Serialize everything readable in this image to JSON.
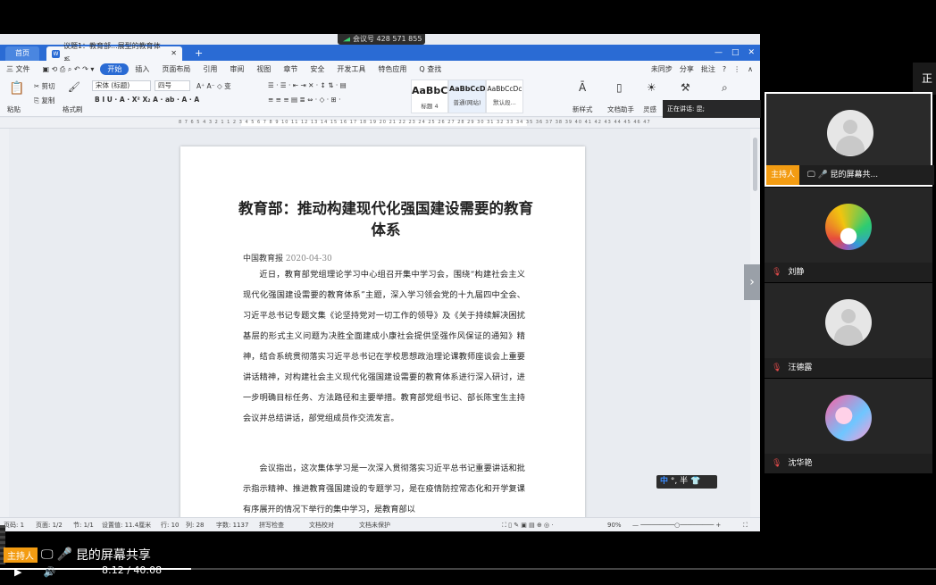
{
  "meeting": {
    "id_text": "会议号 428 571 855"
  },
  "wps": {
    "tabs": {
      "home": "首页",
      "doc": "议题1：教育部...展型的教育体系"
    },
    "menu": [
      "三 文件",
      "开始",
      "插入",
      "页面布局",
      "引用",
      "审阅",
      "视图",
      "章节",
      "安全",
      "开发工具",
      "特色应用",
      "Q 查找"
    ],
    "menu_active": "开始",
    "menu_right": [
      "未同步",
      "分享",
      "批注",
      "?"
    ],
    "ribbon": {
      "paste": "粘贴",
      "cut": "剪切",
      "copy": "复制",
      "format_painter": "格式刷",
      "font_name": "宋体 (标题)",
      "font_size": "四号",
      "styles": [
        {
          "preview": "AaBbC",
          "name": "标题 4"
        },
        {
          "preview": "AaBbCcD",
          "name": "普通(网站)"
        },
        {
          "preview": "AaBbCcDc",
          "name": "默认段..."
        }
      ],
      "new_style": "新样式",
      "doc_assistant": "文档助手",
      "inspire": "灵感"
    },
    "ruler_numbers": "8 7 6 5 4 3 2 1 1 2 3 4 5 6 7 8 9 10 11 12 13 14 15 16 17 18 19 20 21 22 23 24 25 26 27 28 29 30 31 32 33 34 35 36 37 38 39 40 41 42 43 44 45 46 47",
    "status": {
      "page_count": "页码: 1",
      "pages": "页面: 1/2",
      "section": "节: 1/1",
      "setting": "设置值: 11.4厘米",
      "row": "行: 10",
      "col": "列: 28",
      "words": "字数: 1137",
      "spell": "拼写检查",
      "proof": "文档校对",
      "protect": "文档未保护",
      "zoom": "90%"
    }
  },
  "document": {
    "title": "教育部：推动构建现代化强国建设需要的教育体系",
    "source": "中国教育报",
    "date": "2020-04-30",
    "para1": "近日，教育部党组理论学习中心组召开集中学习会，围绕“构建社会主义现代化强国建设需要的教育体系”主题，深入学习领会党的十九届四中全会、习近平总书记专题文集《论坚持党对一切工作的领导》及《关于持续解决困扰基层的形式主义问题为决胜全面建成小康社会提供坚强作风保证的通知》精神，结合系统贯彻落实习近平总书记在学校思想政治理论课教师座谈会上重要讲话精神，对构建社会主义现代化强国建设需要的教育体系进行深入研讨，进一步明确目标任务、方法路径和主要举措。教育部党组书记、部长陈宝生主持会议并总结讲话，部党组成员作交流发言。",
    "para2": "会议指出，这次集体学习是一次深入贯彻落实习近平总书记重要讲话和批示指示精神、推进教育强国建设的专题学习，是在疫情防控常态化和开学复课有序展开的情况下举行的集中学习，是教育部以"
  },
  "ime": {
    "text": "中 °, 半 👕",
    "zh": "中",
    "rest": "°, 半"
  },
  "speaking": "正在讲话: 昆;",
  "participants": [
    {
      "name": "昆的屏幕共...",
      "host": true,
      "host_label": "主持人",
      "avatar": "default"
    },
    {
      "name": "刘静",
      "host": false,
      "avatar": "rainbow"
    },
    {
      "name": "汪德露",
      "host": false,
      "avatar": "default"
    },
    {
      "name": "沈华艳",
      "host": false,
      "avatar": "anime"
    }
  ],
  "right_edge_char": "正",
  "video": {
    "host_label": "主持人",
    "share_label": "昆的屏幕共享",
    "time": "8:12 / 40:08",
    "progress": 0.2044
  }
}
